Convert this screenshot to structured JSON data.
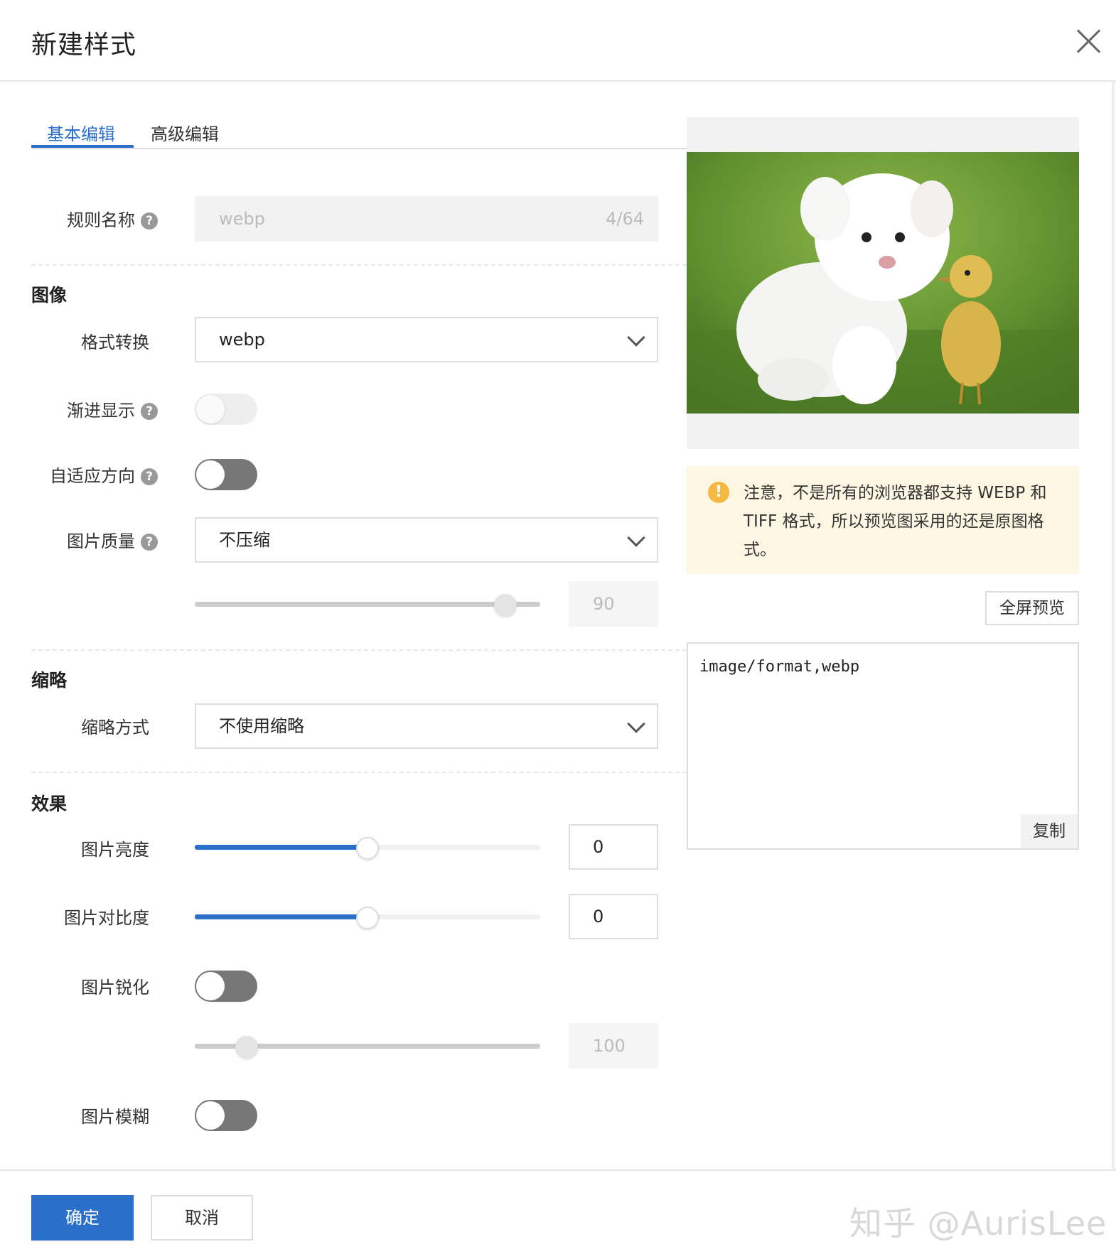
{
  "dialog": {
    "title": "新建样式"
  },
  "tabs": [
    {
      "label": "基本编辑",
      "active": true
    },
    {
      "label": "高级编辑",
      "active": false
    }
  ],
  "rule_name": {
    "label": "规则名称",
    "value": "webp",
    "counter": "4/64"
  },
  "sections": {
    "image": "图像",
    "thumbnail": "缩略",
    "effects": "效果"
  },
  "format": {
    "label": "格式转换",
    "value": "webp"
  },
  "progressive": {
    "label": "渐进显示",
    "enabled": false,
    "disabled": true
  },
  "auto_orient": {
    "label": "自适应方向",
    "enabled": false
  },
  "quality": {
    "label": "图片质量",
    "value": "不压缩",
    "slider_value": "90",
    "slider_fraction": 0.9
  },
  "thumbnail_mode": {
    "label": "缩略方式",
    "value": "不使用缩略"
  },
  "brightness": {
    "label": "图片亮度",
    "value": "0",
    "slider_fraction": 0.5
  },
  "contrast": {
    "label": "图片对比度",
    "value": "0",
    "slider_fraction": 0.5
  },
  "sharpen": {
    "label": "图片锐化",
    "enabled": false,
    "slider_value": "100",
    "slider_fraction": 0.15
  },
  "blur": {
    "label": "图片模糊",
    "enabled": false
  },
  "notice": {
    "text": "注意，不是所有的浏览器都支持 WEBP 和 TIFF 格式，所以预览图采用的还是原图格式。"
  },
  "preview": {
    "fullscreen_label": "全屏预览"
  },
  "code": {
    "value": "image/format,webp",
    "copy_label": "复制"
  },
  "footer": {
    "confirm_label": "确定",
    "cancel_label": "取消",
    "watermark": "知乎 @AurisLee"
  },
  "colors": {
    "accent": "#2a6fc9",
    "notice_bg": "#fdf6e3",
    "notice_icon": "#f5b942"
  }
}
